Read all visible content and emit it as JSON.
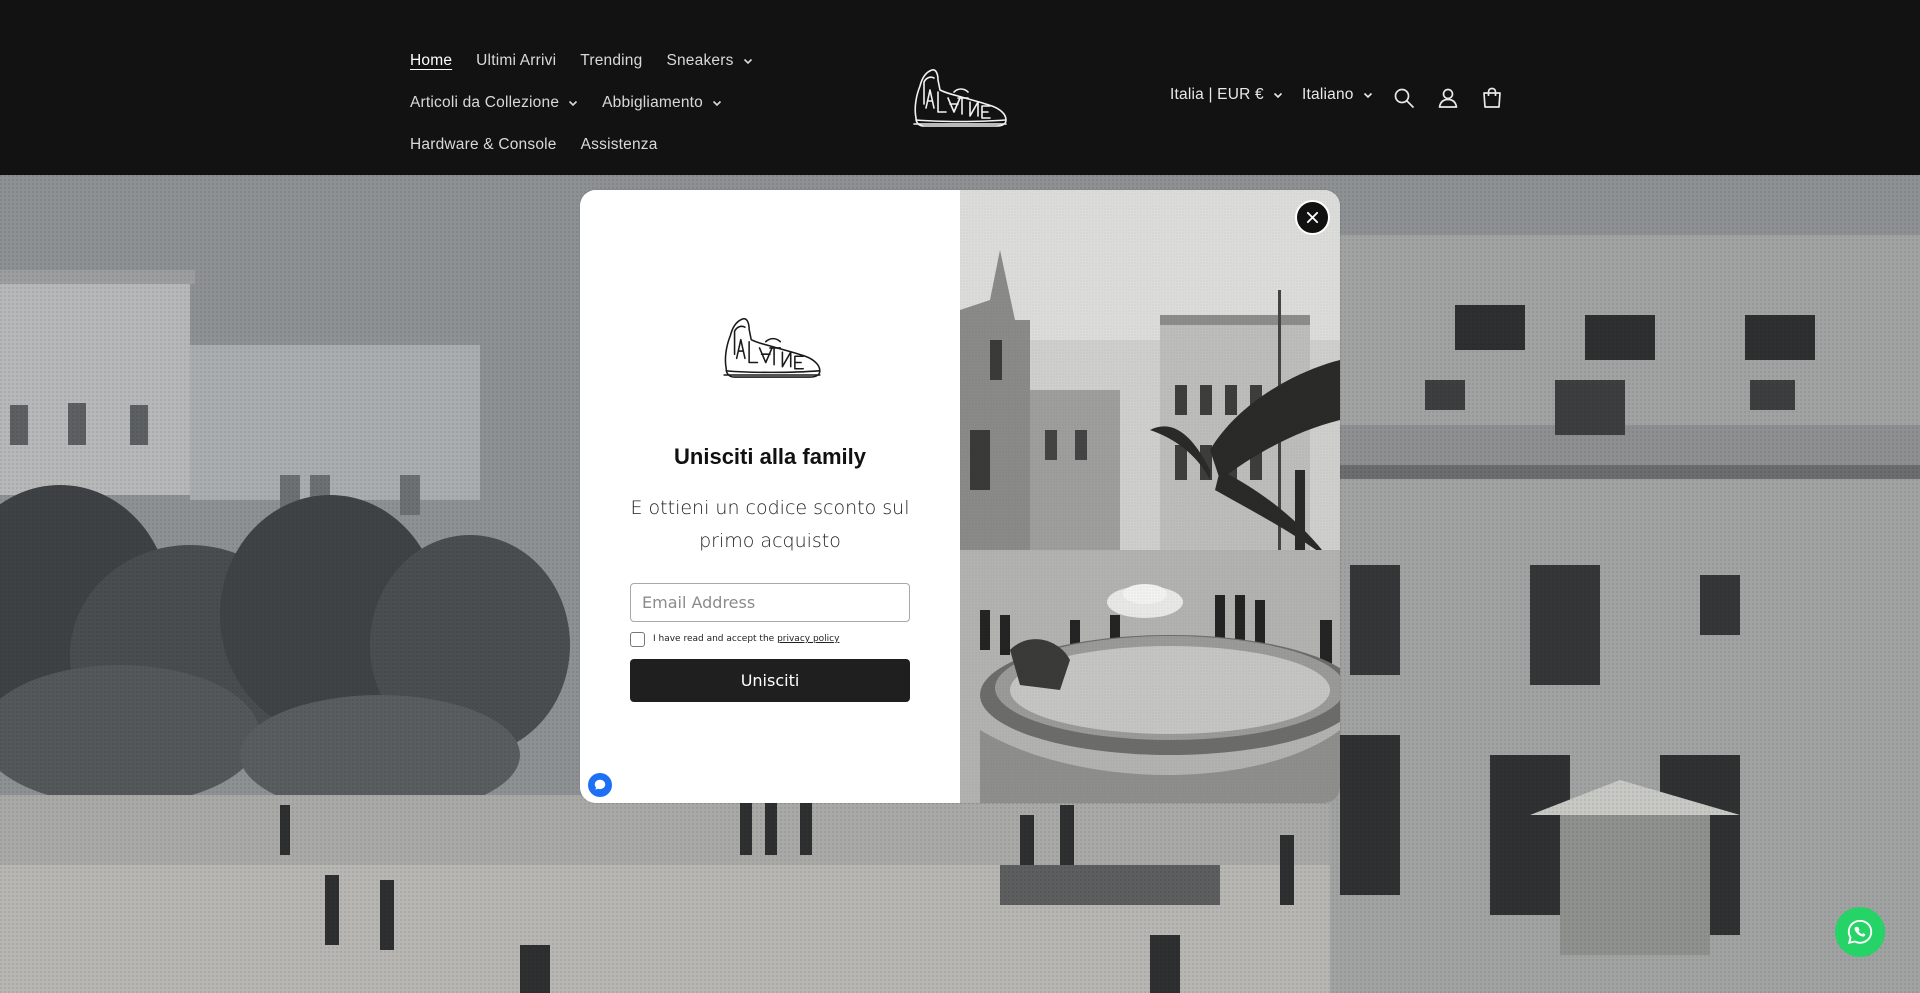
{
  "header": {
    "nav": [
      {
        "label": "Home",
        "active": true,
        "dropdown": false
      },
      {
        "label": "Ultimi Arrivi",
        "dropdown": false
      },
      {
        "label": "Trending",
        "dropdown": false
      },
      {
        "label": "Sneakers",
        "dropdown": true
      },
      {
        "label": "Articoli da Collezione",
        "dropdown": true
      },
      {
        "label": "Abbigliamento",
        "dropdown": true
      },
      {
        "label": "Hardware & Console",
        "dropdown": false
      },
      {
        "label": "Assistenza",
        "dropdown": false
      }
    ],
    "logo_icon": "sneaker-logo-icon",
    "country_selector": "Italia | EUR €",
    "language_selector": "Italiano",
    "icons": [
      "search-icon",
      "account-icon",
      "cart-icon"
    ]
  },
  "popup": {
    "title": "Unisciti alla family",
    "subtitle": "E ottieni un codice sconto sul primo acquisto",
    "email_placeholder": "Email Address",
    "email_value": "",
    "consent_text": "I have read and accept the ",
    "consent_link": "privacy policy",
    "consent_checked": false,
    "submit_label": "Unisciti",
    "close_icon": "close-icon",
    "badge_icon": "chat-bubble-icon"
  },
  "floating": {
    "whatsapp_icon": "whatsapp-icon"
  },
  "colors": {
    "header_bg": "#121212",
    "button_bg": "#1f1f1f",
    "whatsapp": "#25d366",
    "badge": "#1d70f5"
  }
}
